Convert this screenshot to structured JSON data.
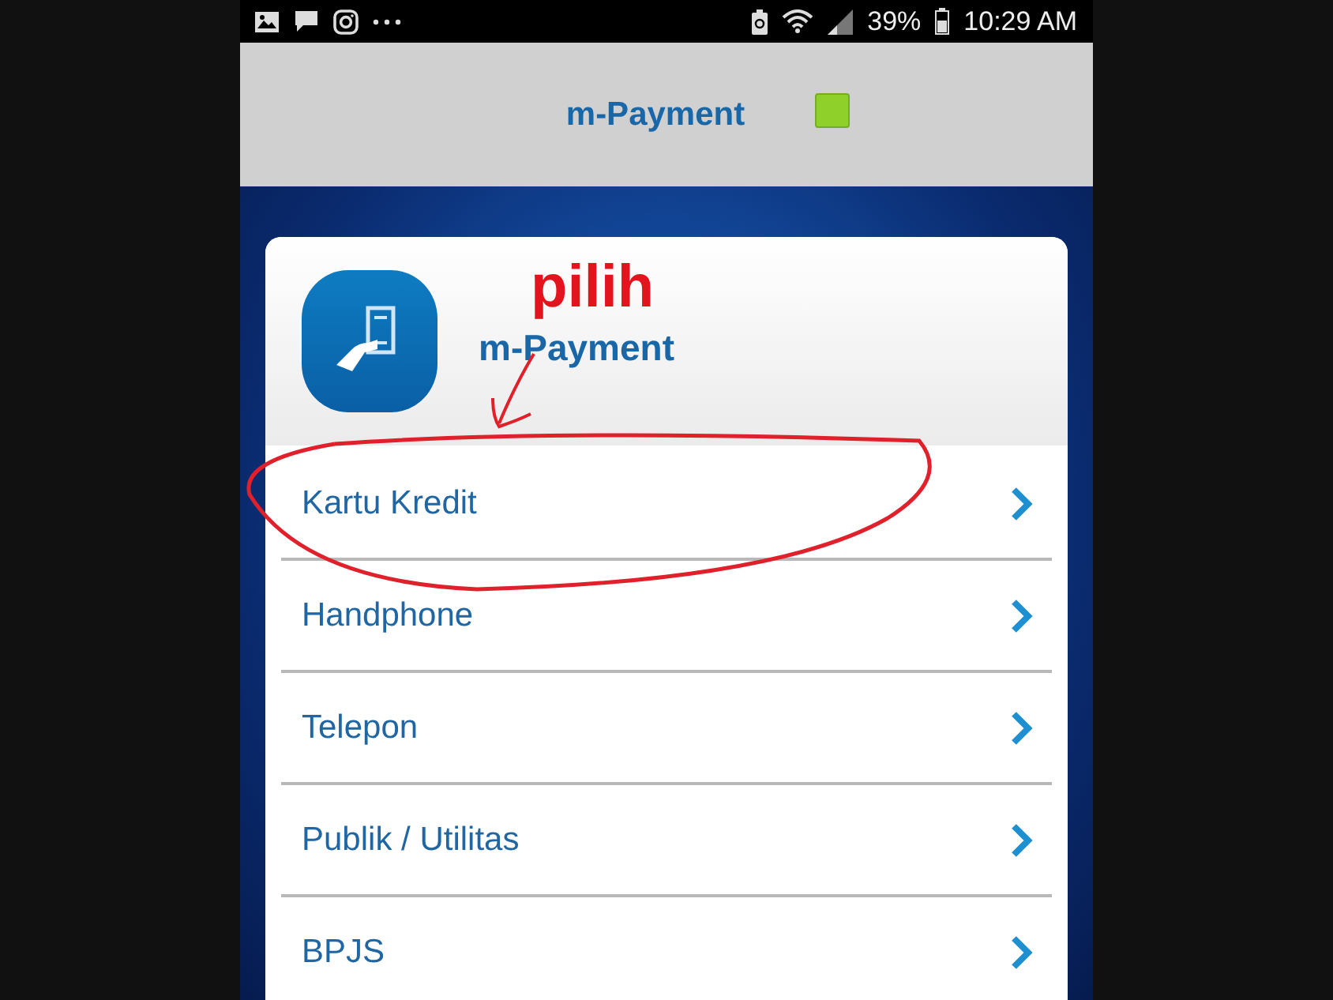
{
  "status_bar": {
    "battery_percent": "39%",
    "time": "10:29 AM"
  },
  "app_bar": {
    "title": "m-Payment"
  },
  "card": {
    "title": "m-Payment"
  },
  "menu": [
    {
      "label": "Kartu Kredit",
      "circled": true
    },
    {
      "label": "Handphone",
      "circled": false
    },
    {
      "label": "Telepon",
      "circled": false
    },
    {
      "label": "Publik / Utilitas",
      "circled": false
    },
    {
      "label": "BPJS",
      "circled": false
    }
  ],
  "annotation": {
    "text": "pilih"
  }
}
